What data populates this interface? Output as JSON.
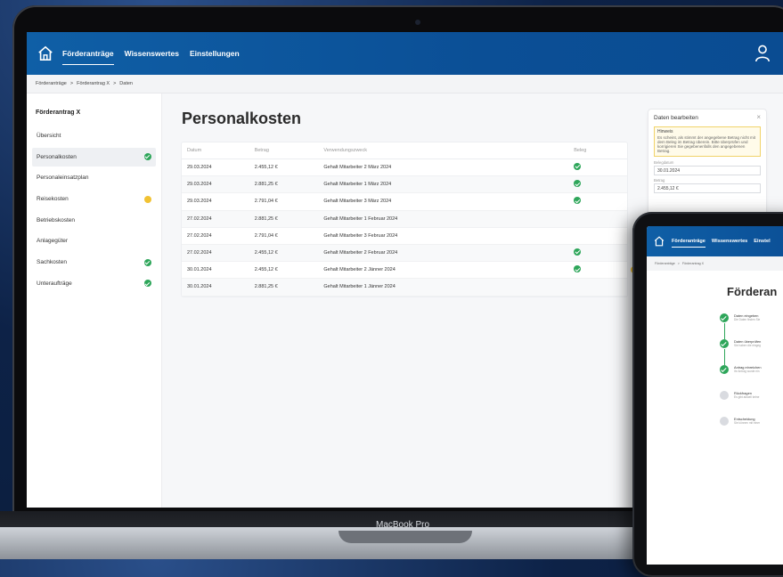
{
  "laptop": {
    "nav": {
      "items": [
        "Förderanträge",
        "Wissenswertes",
        "Einstellungen"
      ],
      "active": 0
    },
    "breadcrumb": [
      "Förderanträge",
      ">",
      "Förderantrag X",
      ">",
      "Daten"
    ],
    "sidebar": {
      "title": "Förderantrag X",
      "items": [
        {
          "label": "Übersicht",
          "status": ""
        },
        {
          "label": "Personalkosten",
          "status": "ok"
        },
        {
          "label": "Personaleinsatzplan",
          "status": ""
        },
        {
          "label": "Reisekosten",
          "status": "warn"
        },
        {
          "label": "Betriebskosten",
          "status": ""
        },
        {
          "label": "Anlagegüter",
          "status": ""
        },
        {
          "label": "Sachkosten",
          "status": "ok"
        },
        {
          "label": "Unteraufträge",
          "status": "ok"
        }
      ]
    },
    "page_title": "Personalkosten",
    "table": {
      "headers": [
        "Datum",
        "Betrag",
        "Verwendungszweck",
        "Beleg"
      ],
      "rows": [
        {
          "date": "29.03.2024",
          "amount": "2.455,12 €",
          "purpose": "Gehalt Mitarbeiter 2 März 2024",
          "ok": true,
          "warn": false
        },
        {
          "date": "29.03.2024",
          "amount": "2.881,25 €",
          "purpose": "Gehalt Mitarbeiter 1 März 2024",
          "ok": true,
          "warn": false
        },
        {
          "date": "29.03.2024",
          "amount": "2.791,04 €",
          "purpose": "Gehalt Mitarbeiter 3 März 2024",
          "ok": true,
          "warn": false
        },
        {
          "date": "27.02.2024",
          "amount": "2.881,25 €",
          "purpose": "Gehalt Mitarbeiter 1 Februar 2024",
          "ok": false,
          "warn": false
        },
        {
          "date": "27.02.2024",
          "amount": "2.791,04 €",
          "purpose": "Gehalt Mitarbeiter 3 Februar 2024",
          "ok": false,
          "warn": false
        },
        {
          "date": "27.02.2024",
          "amount": "2.455,12 €",
          "purpose": "Gehalt Mitarbeiter 2 Februar 2024",
          "ok": true,
          "warn": false
        },
        {
          "date": "30.01.2024",
          "amount": "2.455,12 €",
          "purpose": "Gehalt Mitarbeiter 2 Jänner 2024",
          "ok": true,
          "warn": true
        },
        {
          "date": "30.01.2024",
          "amount": "2.881,25 €",
          "purpose": "Gehalt Mitarbeiter 1 Jänner 2024",
          "ok": false,
          "warn": false
        }
      ]
    },
    "panel": {
      "title": "Daten bearbeiten",
      "hint_title": "Hinweis",
      "hint_text": "Es scheint, als stimmt der angegebene Betrag nicht mit dem Beleg im Betrag überein. Bitte überprüfen und korrigieren Sie gegebenenfalls den angegebenen Betrag.",
      "date_label": "Belegdatum",
      "date_value": "30.01.2024",
      "amount_label": "Betrag",
      "amount_value": "2.455,12 €"
    },
    "model_label": "MacBook Pro"
  },
  "tablet": {
    "nav": [
      "Förderanträge",
      "Wissenswertes",
      "Einstel"
    ],
    "breadcrumb": [
      "Förderanträge",
      ">",
      "Förderantrag X"
    ],
    "title": "Förderan",
    "steps": [
      {
        "name": "Daten eingeben",
        "sub": "Die Daten finden Sie",
        "done": true
      },
      {
        "name": "Daten überprüfen",
        "sub": "Sie haben die eingeg",
        "done": true
      },
      {
        "name": "Antrag einreichen",
        "sub": "Ihr Antrag wurde ein",
        "done": true
      },
      {
        "name": "Rückfragen",
        "sub": "Es gibt aktuell keine",
        "done": false
      },
      {
        "name": "Entscheidung",
        "sub": "Sie können mit einer",
        "done": false
      }
    ]
  },
  "colors": {
    "brand": "#0b4f96",
    "ok": "#2ea65a",
    "warn": "#f1c232"
  }
}
